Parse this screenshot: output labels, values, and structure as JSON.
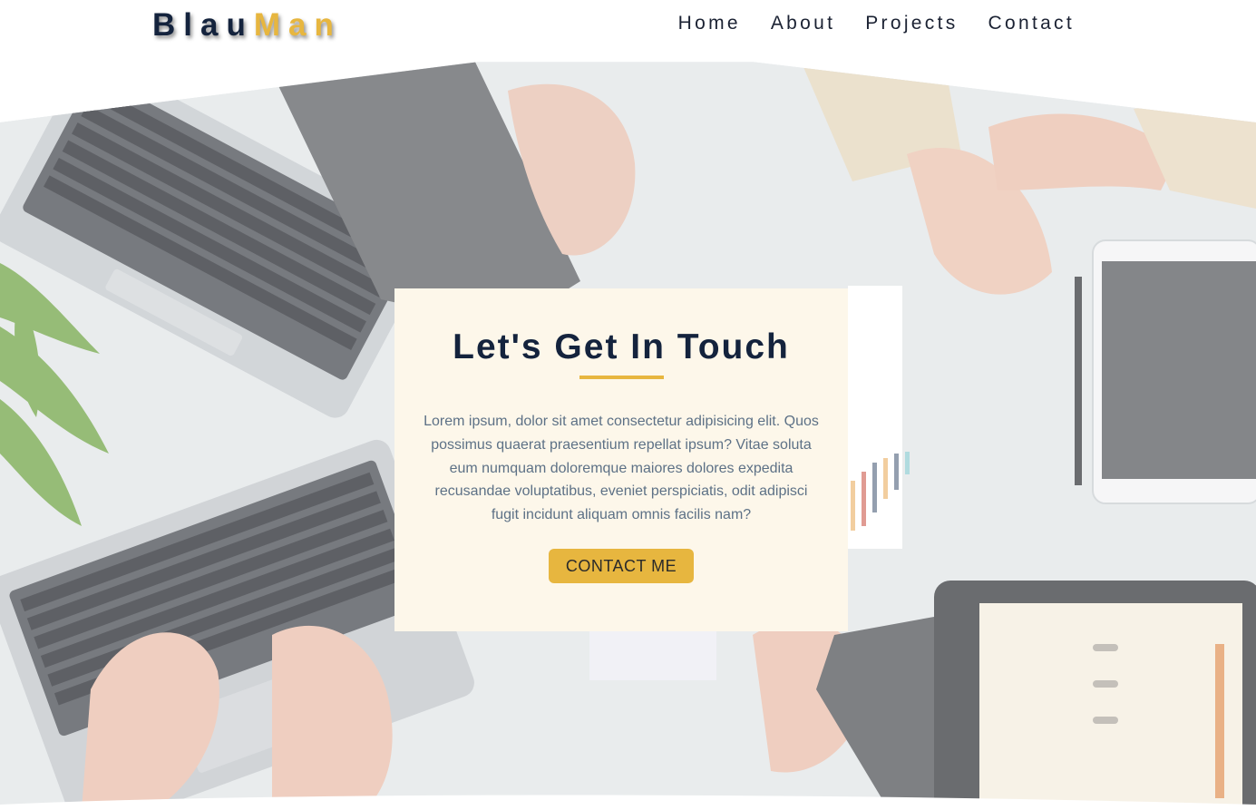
{
  "brand": {
    "logo_part1": "Blau",
    "logo_part2": "Man",
    "colors": {
      "navy": "#14233d",
      "gold": "#e7b63f",
      "card_bg": "#fdf7ea",
      "body_text": "#5d7186"
    }
  },
  "nav": {
    "links": [
      {
        "label": "Home"
      },
      {
        "label": "About"
      },
      {
        "label": "Projects"
      },
      {
        "label": "Contact"
      }
    ]
  },
  "hero": {
    "background_image": "office-desk-laptops-hands-photo"
  },
  "contact_card": {
    "title": "Let's Get In Touch",
    "body": "Lorem ipsum, dolor sit amet consectetur adipisicing elit. Quos possimus quaerat praesentium repellat ipsum? Vitae soluta eum numquam doloremque maiores dolores expedita recusandae voluptatibus, eveniet perspiciatis, odit adipisci fugit incidunt aliquam omnis facilis nam?",
    "button_label": "CONTACT ME"
  }
}
